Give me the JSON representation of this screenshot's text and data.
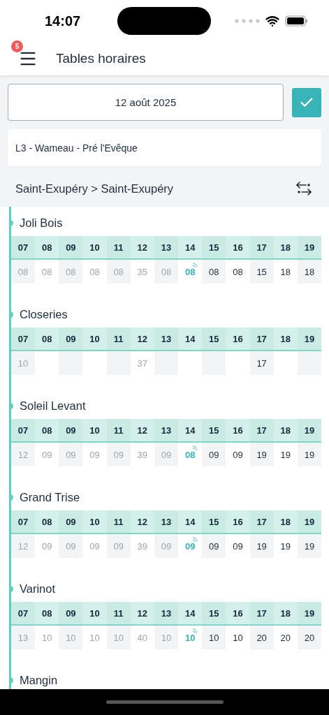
{
  "status_bar": {
    "time": "14:07"
  },
  "header": {
    "title": "Tables horaires",
    "badge": "5"
  },
  "date_field": {
    "value": "12 août 2025"
  },
  "route": {
    "label": "L3 - Wameau - Pré l'Evêque"
  },
  "direction": {
    "label": "Saint-Exupéry > Saint-Exupéry"
  },
  "stops": [
    {
      "name": "Joli Bois",
      "hours": [
        "07",
        "08",
        "09",
        "10",
        "11",
        "12",
        "13",
        "14",
        "15",
        "16",
        "17",
        "18",
        "19"
      ],
      "cells": [
        {
          "kind": "past",
          "text": "08"
        },
        {
          "kind": "past",
          "text": "08"
        },
        {
          "kind": "past",
          "text": "08"
        },
        {
          "kind": "past",
          "text": "08"
        },
        {
          "kind": "past",
          "text": "08"
        },
        {
          "kind": "past",
          "text": "35"
        },
        {
          "kind": "past",
          "text": "08"
        },
        {
          "kind": "live",
          "text": "08"
        },
        {
          "kind": "future",
          "text": "08"
        },
        {
          "kind": "future",
          "text": "08"
        },
        {
          "kind": "future",
          "text": "15"
        },
        {
          "kind": "future",
          "text": "18"
        },
        {
          "kind": "future",
          "text": "18"
        }
      ]
    },
    {
      "name": "Closeries",
      "hours": [
        "07",
        "08",
        "09",
        "10",
        "11",
        "12",
        "13",
        "14",
        "15",
        "16",
        "17",
        "18",
        "19"
      ],
      "cells": [
        {
          "kind": "past",
          "text": "10"
        },
        {
          "kind": "empty"
        },
        {
          "kind": "empty"
        },
        {
          "kind": "empty"
        },
        {
          "kind": "empty"
        },
        {
          "kind": "past",
          "text": "37"
        },
        {
          "kind": "empty"
        },
        {
          "kind": "empty"
        },
        {
          "kind": "empty"
        },
        {
          "kind": "empty"
        },
        {
          "kind": "future",
          "text": "17"
        },
        {
          "kind": "empty"
        },
        {
          "kind": "empty"
        }
      ]
    },
    {
      "name": "Soleil Levant",
      "hours": [
        "07",
        "08",
        "09",
        "10",
        "11",
        "12",
        "13",
        "14",
        "15",
        "16",
        "17",
        "18",
        "19"
      ],
      "cells": [
        {
          "kind": "past",
          "text": "12"
        },
        {
          "kind": "past",
          "text": "09"
        },
        {
          "kind": "past",
          "text": "09"
        },
        {
          "kind": "past",
          "text": "09"
        },
        {
          "kind": "past",
          "text": "09"
        },
        {
          "kind": "past",
          "text": "39"
        },
        {
          "kind": "past",
          "text": "09"
        },
        {
          "kind": "live",
          "text": "08"
        },
        {
          "kind": "future",
          "text": "09"
        },
        {
          "kind": "future",
          "text": "09"
        },
        {
          "kind": "future",
          "text": "19"
        },
        {
          "kind": "future",
          "text": "19"
        },
        {
          "kind": "future",
          "text": "19"
        }
      ]
    },
    {
      "name": "Grand Trise",
      "hours": [
        "07",
        "08",
        "09",
        "10",
        "11",
        "12",
        "13",
        "14",
        "15",
        "16",
        "17",
        "18",
        "19"
      ],
      "cells": [
        {
          "kind": "past",
          "text": "12"
        },
        {
          "kind": "past",
          "text": "09"
        },
        {
          "kind": "past",
          "text": "09"
        },
        {
          "kind": "past",
          "text": "09"
        },
        {
          "kind": "past",
          "text": "09"
        },
        {
          "kind": "past",
          "text": "39"
        },
        {
          "kind": "past",
          "text": "09"
        },
        {
          "kind": "live",
          "text": "09"
        },
        {
          "kind": "future",
          "text": "09"
        },
        {
          "kind": "future",
          "text": "09"
        },
        {
          "kind": "future",
          "text": "19"
        },
        {
          "kind": "future",
          "text": "19"
        },
        {
          "kind": "future",
          "text": "19"
        }
      ]
    },
    {
      "name": "Varinot",
      "hours": [
        "07",
        "08",
        "09",
        "10",
        "11",
        "12",
        "13",
        "14",
        "15",
        "16",
        "17",
        "18",
        "19"
      ],
      "cells": [
        {
          "kind": "past",
          "text": "13"
        },
        {
          "kind": "past",
          "text": "10"
        },
        {
          "kind": "past",
          "text": "10"
        },
        {
          "kind": "past",
          "text": "10"
        },
        {
          "kind": "past",
          "text": "10"
        },
        {
          "kind": "past",
          "text": "40"
        },
        {
          "kind": "past",
          "text": "10"
        },
        {
          "kind": "live",
          "text": "10"
        },
        {
          "kind": "future",
          "text": "10"
        },
        {
          "kind": "future",
          "text": "10"
        },
        {
          "kind": "future",
          "text": "20"
        },
        {
          "kind": "future",
          "text": "20"
        },
        {
          "kind": "future",
          "text": "20"
        }
      ]
    },
    {
      "name": "Mangin"
    }
  ]
}
